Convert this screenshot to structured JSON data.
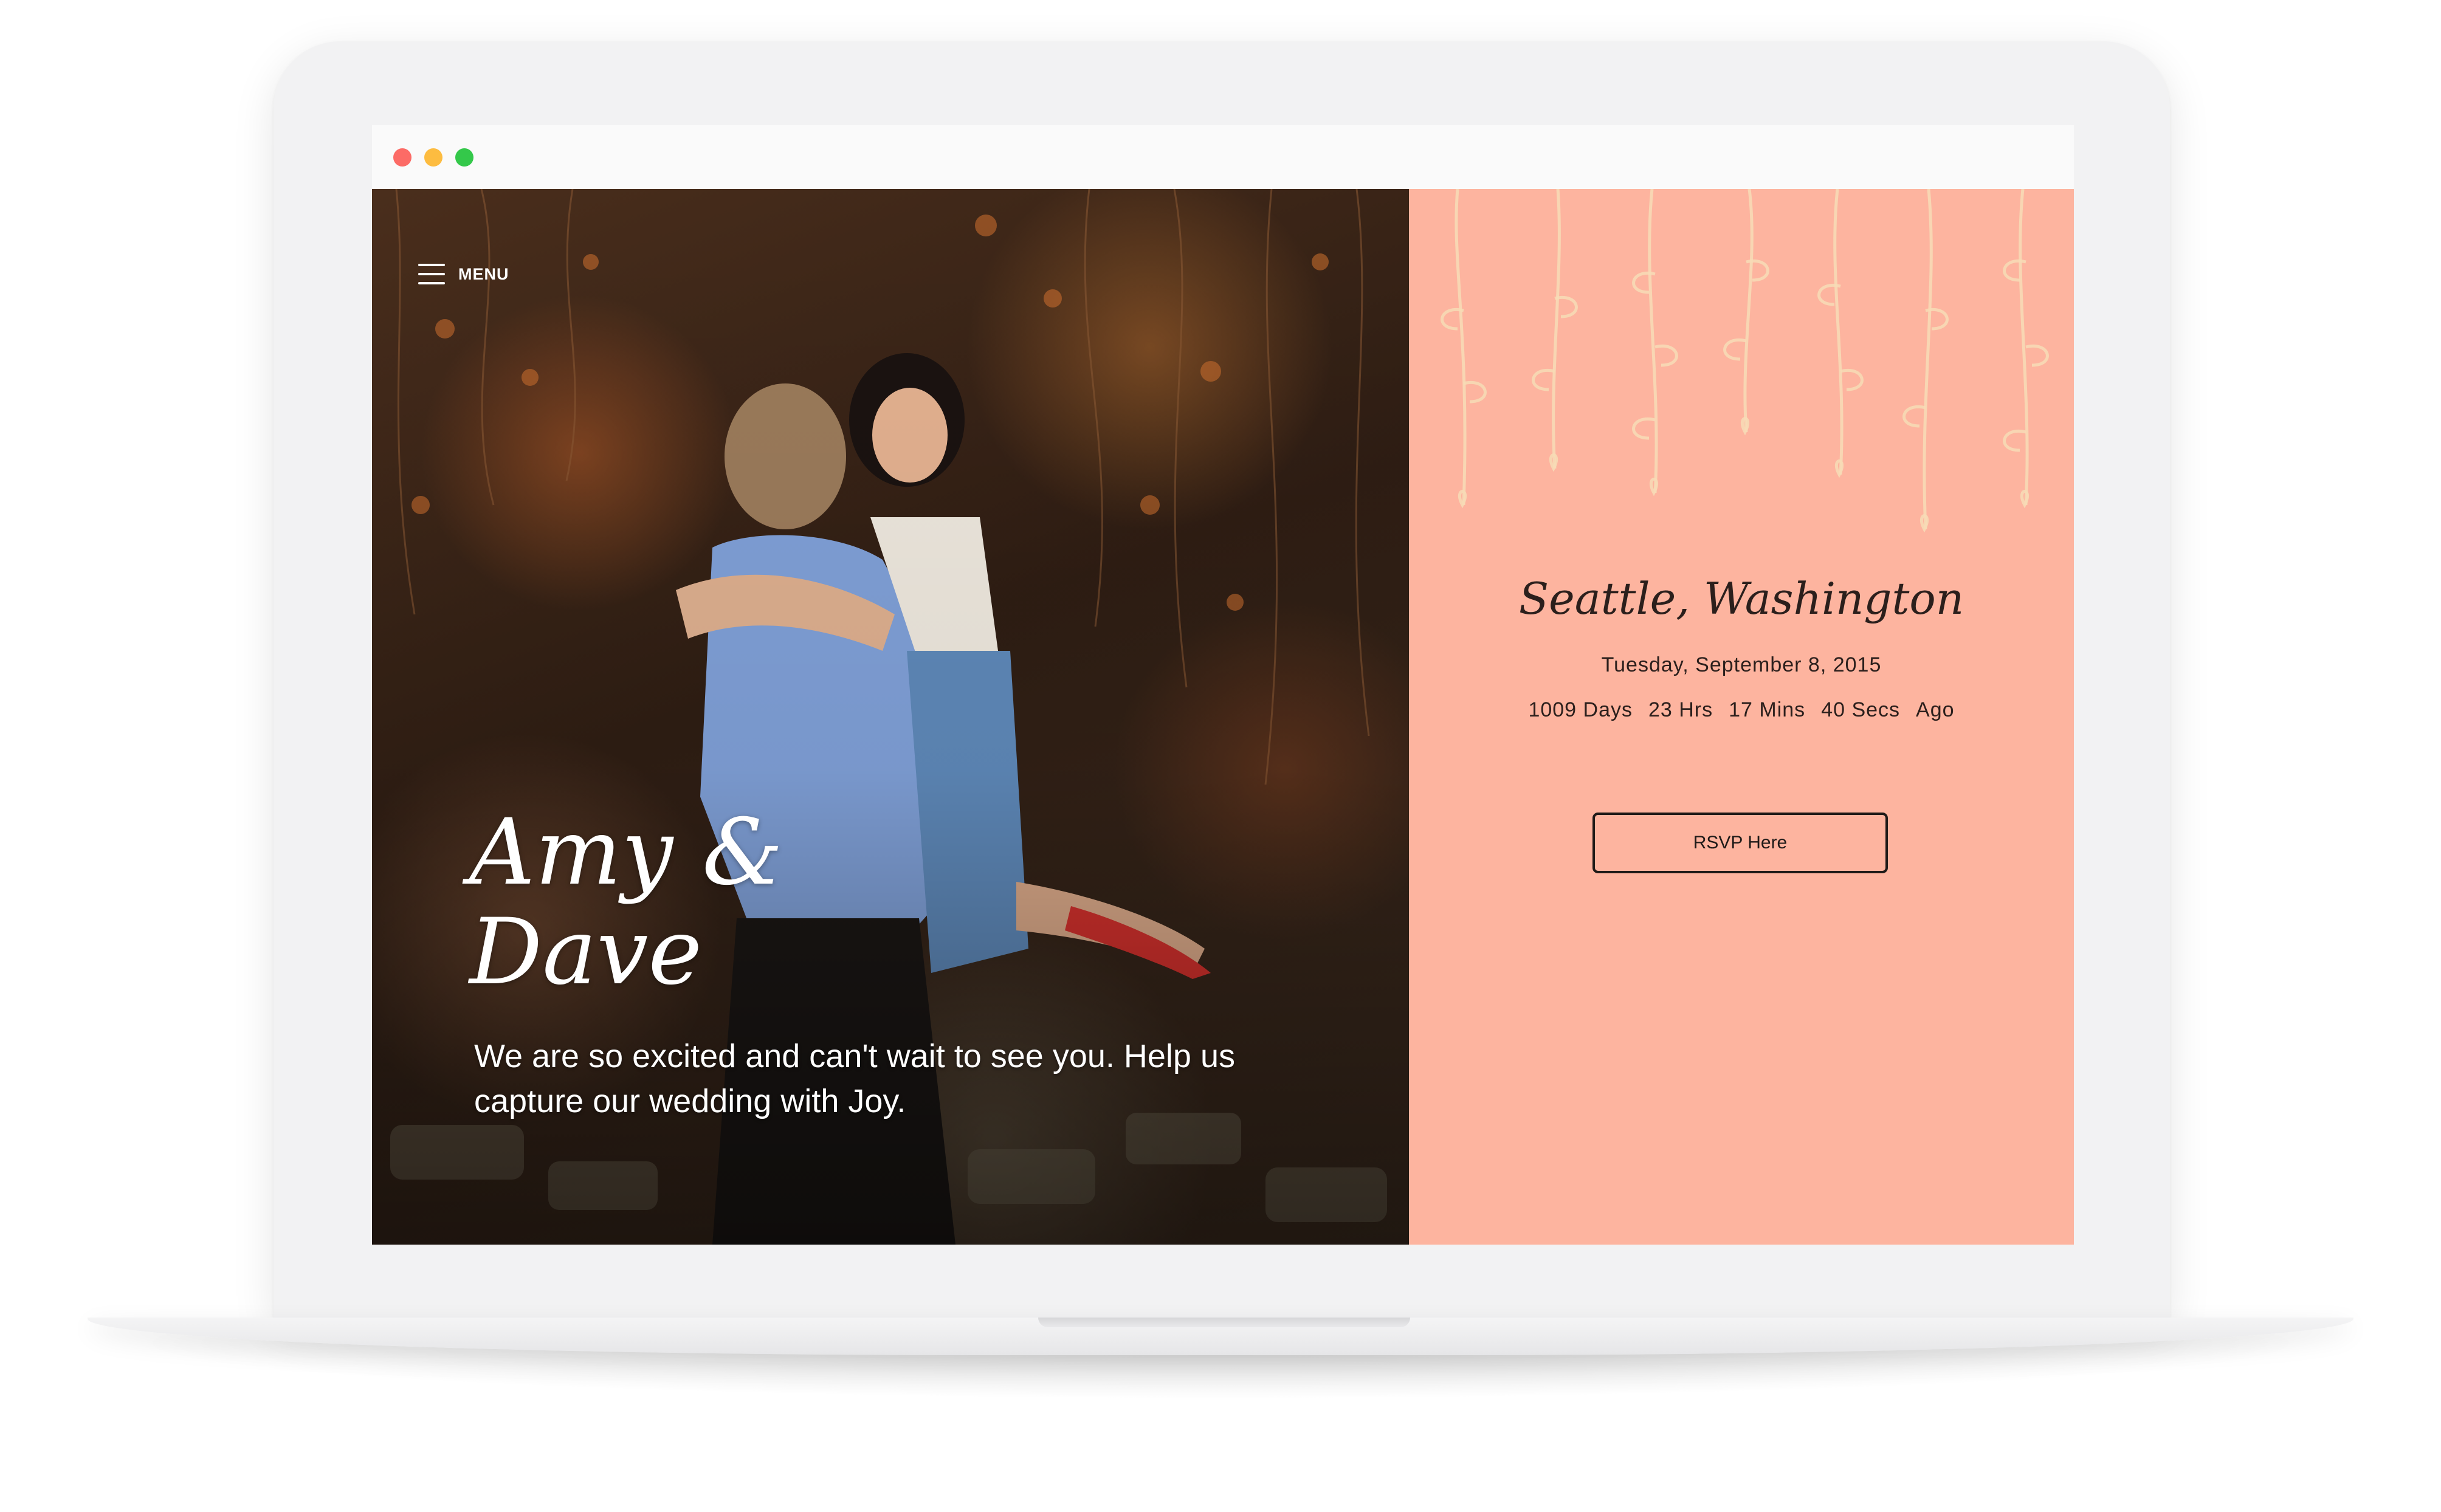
{
  "window": {
    "traffic_lights": {
      "close_color": "#fc6b66",
      "minimize_color": "#fdbc40",
      "maximize_color": "#34c84a"
    }
  },
  "hero": {
    "menu_label": "MENU",
    "menu_icon": "hamburger-icon",
    "couple_names": "Amy &\nDave",
    "tagline": "We are so excited and can't wait to see you. Help us capture our wedding with Joy."
  },
  "details": {
    "background_color": "#fdb49f",
    "location": "Seattle, Washington",
    "date": "Tuesday, September 8, 2015",
    "countdown": {
      "days": "1009 Days",
      "hours": "23 Hrs",
      "minutes": "17 Mins",
      "seconds": "40 Secs",
      "suffix": "Ago"
    },
    "rsvp_label": "RSVP Here"
  }
}
